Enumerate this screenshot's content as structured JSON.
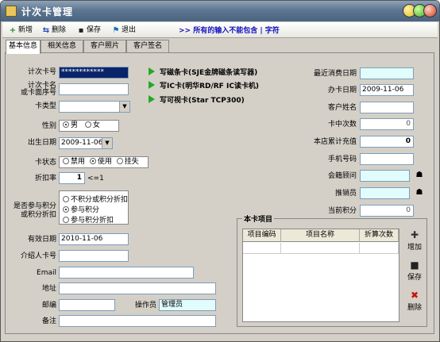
{
  "window": {
    "title": "计次卡管理"
  },
  "toolbar": {
    "add": "新增",
    "delete": "删除",
    "save": "保存",
    "exit": "退出",
    "note": ">> 所有的输入不能包含 | 字符"
  },
  "tabs": [
    "基本信息",
    "相关信息",
    "客户照片",
    "客户签名"
  ],
  "left": {
    "card_no_label": "计次卡号",
    "card_no_value": "************",
    "card_name_label_1": "计次卡名",
    "card_name_label_2": "或卡面序号",
    "card_name_value": "",
    "card_type_label": "卡类型",
    "card_type_value": "",
    "gender_label": "性别",
    "gender_male": "男",
    "gender_female": "女",
    "birthday_label": "出生日期",
    "birthday_value": "2009-11-06",
    "status_label": "卡状态",
    "status_disabled": "禁用",
    "status_in_use": "使用",
    "status_lost": "挂失",
    "discount_label": "折扣率",
    "discount_value": "1",
    "discount_hint": "<=1",
    "points_label_1": "是否参与积分",
    "points_label_2": "或积分折扣",
    "points_opt1": "不积分或积分折扣",
    "points_opt2": "参与积分",
    "points_opt3": "参与积分折扣",
    "valid_date_label": "有效日期",
    "valid_date_value": "2010-11-06",
    "referrer_label": "介绍人卡号",
    "email_label": "Email",
    "address_label": "地址",
    "zip_label": "邮编",
    "operator_label": "操作员",
    "operator_value": "管理员",
    "remark_label": "备注"
  },
  "actions": [
    "写磁条卡(SJE金牌磁条读写器)",
    "写IC卡(明华RD/RF IC读卡机)",
    "写可视卡(Star TCP300)"
  ],
  "right": {
    "last_consume_label": "最近消费日期",
    "open_date_label": "办卡日期",
    "open_date_value": "2009-11-06",
    "customer_name_label": "客户姓名",
    "card_count_label": "卡中次数",
    "card_count_value": "0",
    "total_recharge_label": "本店累计充值",
    "total_recharge_value": "0",
    "phone_label": "手机号码",
    "consultant_label": "会籍顾问",
    "sales_label": "推销员",
    "current_points_label": "当前积分",
    "current_points_value": "0"
  },
  "items": {
    "title": "本卡项目",
    "col_code": "项目编码",
    "col_name": "项目名称",
    "col_count": "折算次数",
    "add": "增加",
    "save": "保存",
    "delete": "删除"
  }
}
